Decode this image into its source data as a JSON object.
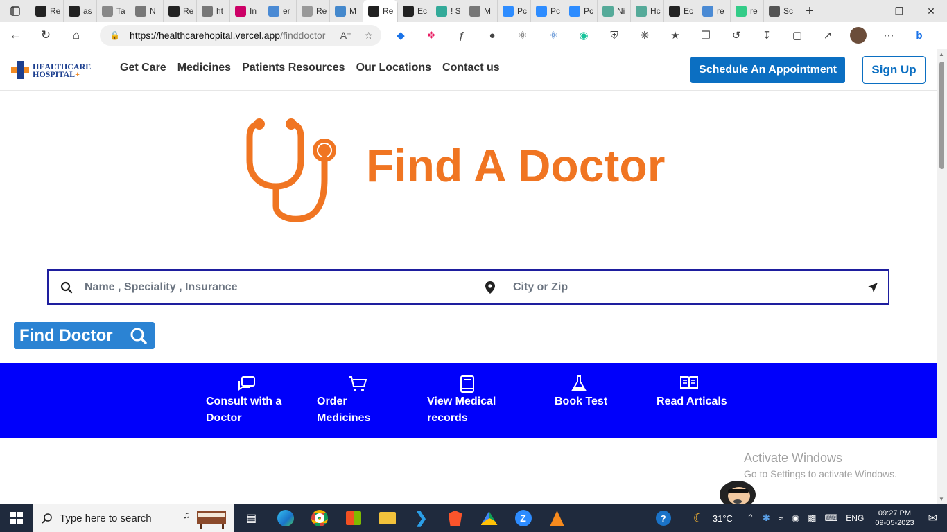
{
  "browser": {
    "tabs": [
      {
        "label": "Re",
        "icon": "react-icon",
        "color": "#222"
      },
      {
        "label": "as",
        "icon": "github-icon",
        "color": "#222"
      },
      {
        "label": "Ta",
        "icon": "globe-icon",
        "color": "#888"
      },
      {
        "label": "N",
        "icon": "page-icon",
        "color": "#777"
      },
      {
        "label": "Re",
        "icon": "react-icon",
        "color": "#222"
      },
      {
        "label": "ht",
        "icon": "page-icon",
        "color": "#777"
      },
      {
        "label": "In",
        "icon": "heart-icon",
        "color": "#c06"
      },
      {
        "label": "er",
        "icon": "search-icon",
        "color": "#4a8ad4"
      },
      {
        "label": "Re",
        "icon": "page-icon",
        "color": "#999"
      },
      {
        "label": "M",
        "icon": "page-icon",
        "color": "#48c"
      },
      {
        "label": "Re",
        "icon": "react-icon",
        "color": "#222",
        "active": true
      },
      {
        "label": "Ec",
        "icon": "github-icon",
        "color": "#222"
      },
      {
        "label": "! S",
        "icon": "star-icon",
        "color": "#3a9"
      },
      {
        "label": "M",
        "icon": "page-icon",
        "color": "#777"
      },
      {
        "label": "Pc",
        "icon": "z-icon",
        "color": "#2d8cff"
      },
      {
        "label": "Pc",
        "icon": "z-icon",
        "color": "#2d8cff"
      },
      {
        "label": "Pc",
        "icon": "z-icon",
        "color": "#2d8cff"
      },
      {
        "label": "Ni",
        "icon": "openai-icon",
        "color": "#5a9"
      },
      {
        "label": "Hc",
        "icon": "openai-icon",
        "color": "#5a9"
      },
      {
        "label": "Ec",
        "icon": "github-icon",
        "color": "#222"
      },
      {
        "label": "re",
        "icon": "search-icon",
        "color": "#4a8ad4"
      },
      {
        "label": "re",
        "icon": "atom-icon",
        "color": "#3c8"
      },
      {
        "label": "Sc",
        "icon": "page-icon",
        "color": "#555"
      }
    ],
    "url_host": "https://healthcarehopital.vercel.app",
    "url_path": "/finddoctor"
  },
  "site": {
    "logo_line1": "HEALTHCARE",
    "logo_line2": "HOSPITAL",
    "logo_plus": "+",
    "menu": [
      "Get Care",
      "Medicines",
      "Patients Resources",
      "Our Locations",
      "Contact us"
    ],
    "schedule_label": "Schedule An Appointment",
    "signup_label": "Sign Up",
    "brand_blue": "#0b6fc2",
    "accent_orange": "#f07522"
  },
  "hero": {
    "title": "Find A Doctor",
    "icon": "stethoscope-icon"
  },
  "search": {
    "query_placeholder": "Name , Speciality , Insurance",
    "location_placeholder": "City or Zip"
  },
  "find_button": "Find Doctor",
  "quick_links": [
    {
      "line1": "Consult with a",
      "line2": "Doctor",
      "icon": "chat-icon"
    },
    {
      "line1": "Order",
      "line2": "Medicines",
      "icon": "cart-icon"
    },
    {
      "line1": "View Medical",
      "line2": "records",
      "icon": "book-icon"
    },
    {
      "line1": "Book Test",
      "line2": "",
      "icon": "flask-icon"
    },
    {
      "line1": "Read Articals",
      "line2": "",
      "icon": "open-book-icon"
    }
  ],
  "watermark": {
    "title": "Activate Windows",
    "subtitle": "Go to Settings to activate Windows."
  },
  "taskbar": {
    "search_placeholder": "Type here to search",
    "weather": "31°C",
    "language": "ENG",
    "time": "09:27 PM",
    "date": "09-05-2023"
  }
}
